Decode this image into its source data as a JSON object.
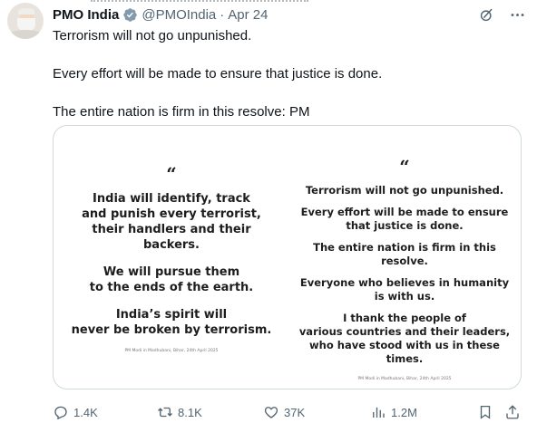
{
  "post": {
    "author_name": "PMO India",
    "handle": "@PMOIndia",
    "separator": "·",
    "date": "Apr 24",
    "lines": [
      "Terrorism will not go unpunished.",
      "Every effort will be made to ensure that justice is done.",
      "The entire nation is firm in this resolve: PM"
    ]
  },
  "media": {
    "left": {
      "quote_mark": "“",
      "lines": [
        "India will identify, track",
        "and punish every terrorist,",
        "their handlers and their backers.",
        "We will pursue them",
        "to the ends of the earth.",
        "India’s spirit will",
        "never be broken by terrorism."
      ],
      "credit": "PM Modi in Madhubani, Bihar, 24th April 2025"
    },
    "right": {
      "quote_mark": "“",
      "lines": [
        "Terrorism will not go unpunished.",
        "Every effort will be made to ensure",
        "that justice is done.",
        "The entire nation is firm in this resolve.",
        "Everyone who believes in humanity",
        "is with us.",
        "I thank the people of",
        "various countries and their leaders,",
        "who have stood with us in these times."
      ],
      "credit": "PM Modi in Madhubani, Bihar, 24th April 2025"
    }
  },
  "actions": {
    "replies": "1.4K",
    "reposts": "8.1K",
    "likes": "37K",
    "views": "1.2M"
  },
  "icons": {
    "verified": "verified-badge-icon",
    "grok": "grok-icon",
    "more": "more-icon",
    "reply": "reply-icon",
    "repost": "repost-icon",
    "like": "like-icon",
    "views": "views-icon",
    "bookmark": "bookmark-icon",
    "share": "share-icon"
  },
  "colors": {
    "text": "#0f1419",
    "secondary": "#536471",
    "verified_gray": "#829aab",
    "border": "#cfd9de"
  }
}
